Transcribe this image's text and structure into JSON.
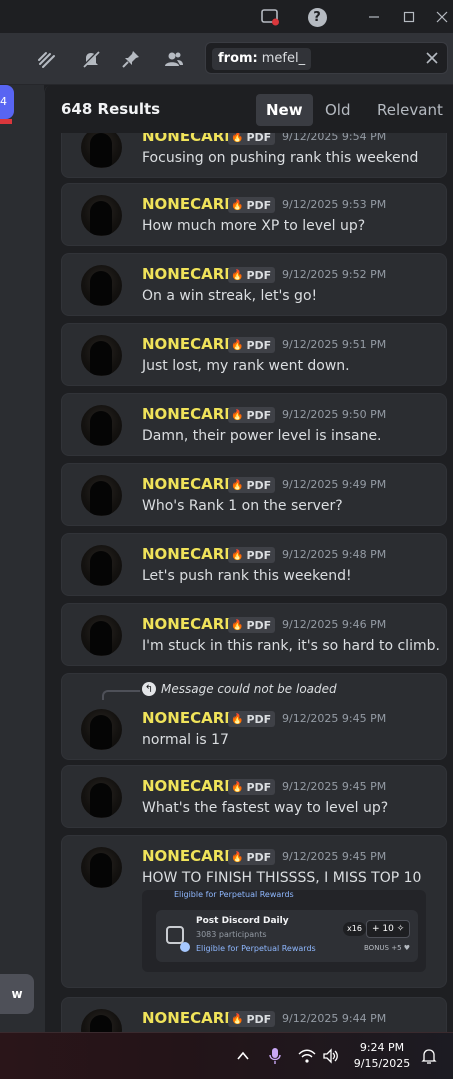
{
  "search": {
    "filter_label": "from:",
    "filter_value": "mefel_"
  },
  "results": {
    "count": "648 Results",
    "sort_new": "New",
    "sort_old": "Old",
    "sort_relevant": "Relevant"
  },
  "left_strip": {
    "badge": "4",
    "button": "w"
  },
  "messages": [
    {
      "username": "NONECARE",
      "tag": "PDF",
      "timestamp": "9/12/2025 9:54 PM",
      "text": "Focusing on pushing rank this weekend"
    },
    {
      "username": "NONECARE",
      "tag": "PDF",
      "timestamp": "9/12/2025 9:53 PM",
      "text": "How much more XP to level up?"
    },
    {
      "username": "NONECARE",
      "tag": "PDF",
      "timestamp": "9/12/2025 9:52 PM",
      "text": "On a win streak, let's go!"
    },
    {
      "username": "NONECARE",
      "tag": "PDF",
      "timestamp": "9/12/2025 9:51 PM",
      "text": "Just lost, my rank went down."
    },
    {
      "username": "NONECARE",
      "tag": "PDF",
      "timestamp": "9/12/2025 9:50 PM",
      "text": "Damn, their power level is insane."
    },
    {
      "username": "NONECARE",
      "tag": "PDF",
      "timestamp": "9/12/2025 9:49 PM",
      "text": "Who's Rank 1 on the server?"
    },
    {
      "username": "NONECARE",
      "tag": "PDF",
      "timestamp": "9/12/2025 9:48 PM",
      "text": "Let's push rank this weekend!"
    },
    {
      "username": "NONECARE",
      "tag": "PDF",
      "timestamp": "9/12/2025 9:46 PM",
      "text": "I'm stuck in this rank, it's so hard to climb."
    },
    {
      "username": "NONECARE",
      "tag": "PDF",
      "timestamp": "9/12/2025 9:45 PM",
      "text": "normal is 17",
      "reply": "Message could not be loaded"
    },
    {
      "username": "NONECARE",
      "tag": "PDF",
      "timestamp": "9/12/2025 9:45 PM",
      "text": "What's the fastest way to level up?"
    },
    {
      "username": "NONECARE",
      "tag": "PDF",
      "timestamp": "9/12/2025 9:45 PM",
      "text": "HOW TO FINISH THISSSS, I MISS TOP 10"
    },
    {
      "username": "NONECARE",
      "tag": "PDF",
      "timestamp": "9/12/2025 9:44 PM",
      "text": ""
    }
  ],
  "embed": {
    "top_line": "Eligible for Perpetual Rewards",
    "title": "Post Discord Daily",
    "participants": "3083 participants",
    "eligible": "Eligible for Perpetual Rewards",
    "multiplier": "x16",
    "points": "+ 10 ✧",
    "bonus": "BONUS +5 ♥"
  },
  "taskbar": {
    "time": "9:24 PM",
    "date": "9/15/2025"
  },
  "colors": {
    "username": "#f0e35a",
    "accent": "#5865f2",
    "danger": "#da373c"
  }
}
